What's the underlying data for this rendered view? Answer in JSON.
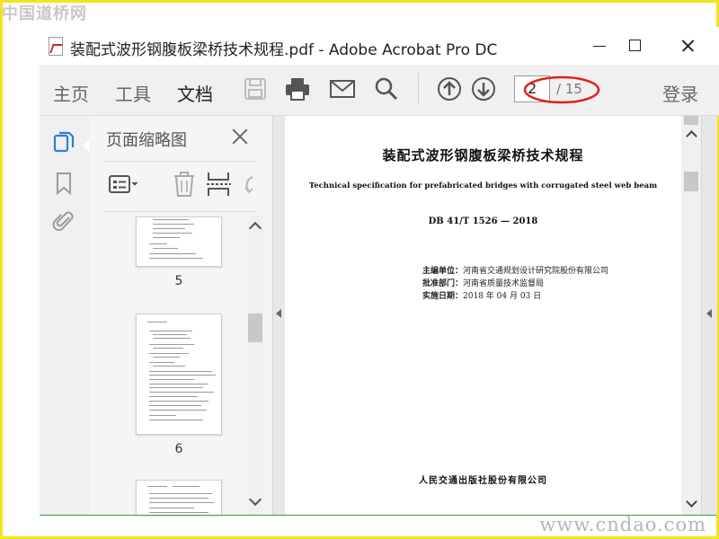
{
  "watermark": {
    "top": "中国道桥网",
    "bottom": "www.cndao.com"
  },
  "window": {
    "title": "装配式波形钢腹板梁桥技术规程.pdf - Adobe Acrobat Pro DC",
    "icon": "pdf-file-icon"
  },
  "toolbar": {
    "tabs": [
      {
        "label": "主页"
      },
      {
        "label": "工具"
      },
      {
        "label": "文档",
        "active": true
      }
    ],
    "icons": [
      "save-icon",
      "print-icon",
      "email-icon",
      "search-icon",
      "previous-page-icon",
      "next-page-icon"
    ],
    "page_current": "2",
    "page_total": "/ 15",
    "login_label": "登录"
  },
  "annotation": {
    "color": "#e02020",
    "shape": "ellipse-around-page-counter"
  },
  "navrail": {
    "icons": [
      "page-thumbnails-icon",
      "bookmark-icon",
      "attachment-icon"
    ]
  },
  "thumbnails_panel": {
    "title": "页面缩略图",
    "tool_icons": [
      "page-options-icon",
      "delete-page-icon",
      "insert-page-icon",
      "rotate-page-icon"
    ],
    "pages": [
      {
        "label": "5"
      },
      {
        "label": "6"
      }
    ]
  },
  "document": {
    "title": "装配式波形钢腹板梁桥技术规程",
    "subtitle_en": "Technical specification for prefabricated bridges with corrugated steel web beam",
    "code": "DB 41/T 1526 — 2018",
    "meta": [
      {
        "label": "主编单位：",
        "value": "河南省交通规划设计研究院股份有限公司"
      },
      {
        "label": "批准部门：",
        "value": "河南省质量技术监督局"
      },
      {
        "label": "实施日期：",
        "value": "2018 年 04 月 03 日"
      }
    ],
    "publisher": "人民交通出版社股份有限公司"
  },
  "colors": {
    "frame": "#f2e41a",
    "toolbar_bg": "#f0f0f0",
    "annotation": "#e02020"
  }
}
